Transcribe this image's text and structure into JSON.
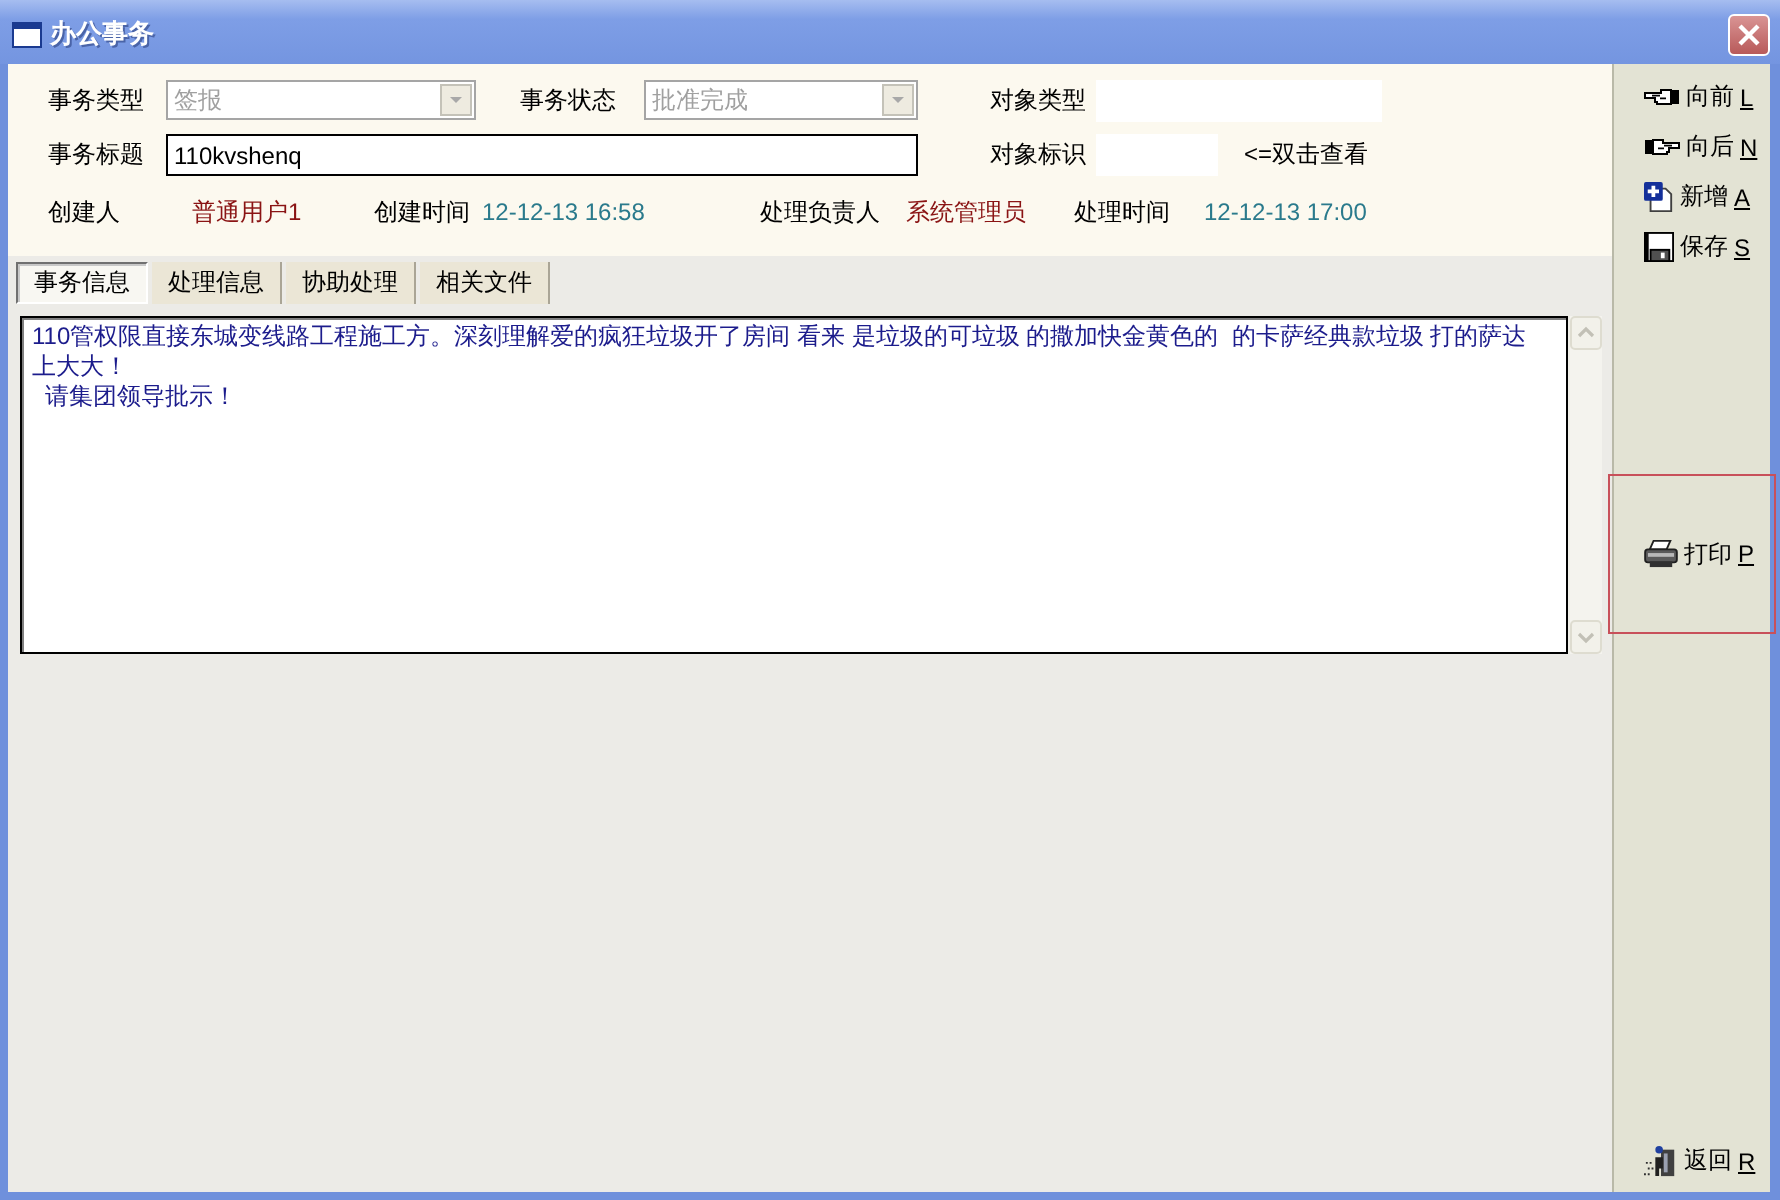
{
  "window": {
    "title": "办公事务"
  },
  "info_rows": [
    [
      {
        "kind": "combo",
        "label": "事务类型",
        "value": "签报",
        "disabled": true
      },
      {
        "kind": "combo",
        "label": "事务状态",
        "value": "批准完成",
        "disabled": true
      },
      {
        "kind": "blank",
        "label": "对象类型"
      }
    ],
    [
      {
        "kind": "input",
        "label": "事务标题",
        "value": "110kvshenq"
      },
      {
        "kind": "blank",
        "label": "对象标识",
        "note": "<=双击查看"
      }
    ],
    [
      {
        "kind": "user",
        "label": "创建人",
        "value": "普通用户1"
      },
      {
        "kind": "time",
        "label": "创建时间",
        "value": "12-12-13 16:58"
      },
      {
        "kind": "user",
        "label": "处理负责人",
        "value": "系统管理员"
      },
      {
        "kind": "time",
        "label": "处理时间",
        "value": "12-12-13 17:00"
      }
    ]
  ],
  "tabs": [
    {
      "label": "事务信息",
      "selected": true
    },
    {
      "label": "处理信息",
      "selected": false
    },
    {
      "label": "协助处理",
      "selected": false
    },
    {
      "label": "相关文件",
      "selected": false
    }
  ],
  "content": {
    "paragraphs": [
      "110管权限直接东城变线路工程施工方。深刻理解爱的疯狂垃圾开了房间 看来 是垃圾的可垃圾 的撒加快金黄色的  的卡萨经典款垃圾 打的萨达上大大！",
      "  请集团领导批示！"
    ]
  },
  "toolbar": {
    "top": [
      {
        "label": "向前",
        "key": "L",
        "highlighted": false
      },
      {
        "label": "向后",
        "key": "N",
        "highlighted": false
      },
      {
        "label": "新增",
        "key": "A",
        "highlighted": false
      },
      {
        "label": "保存",
        "key": "S",
        "highlighted": false
      }
    ],
    "middle": [
      {
        "label": "打印",
        "key": "P",
        "highlighted": true
      }
    ],
    "bottom": [
      {
        "label": "返回",
        "key": "R",
        "highlighted": false
      }
    ]
  }
}
